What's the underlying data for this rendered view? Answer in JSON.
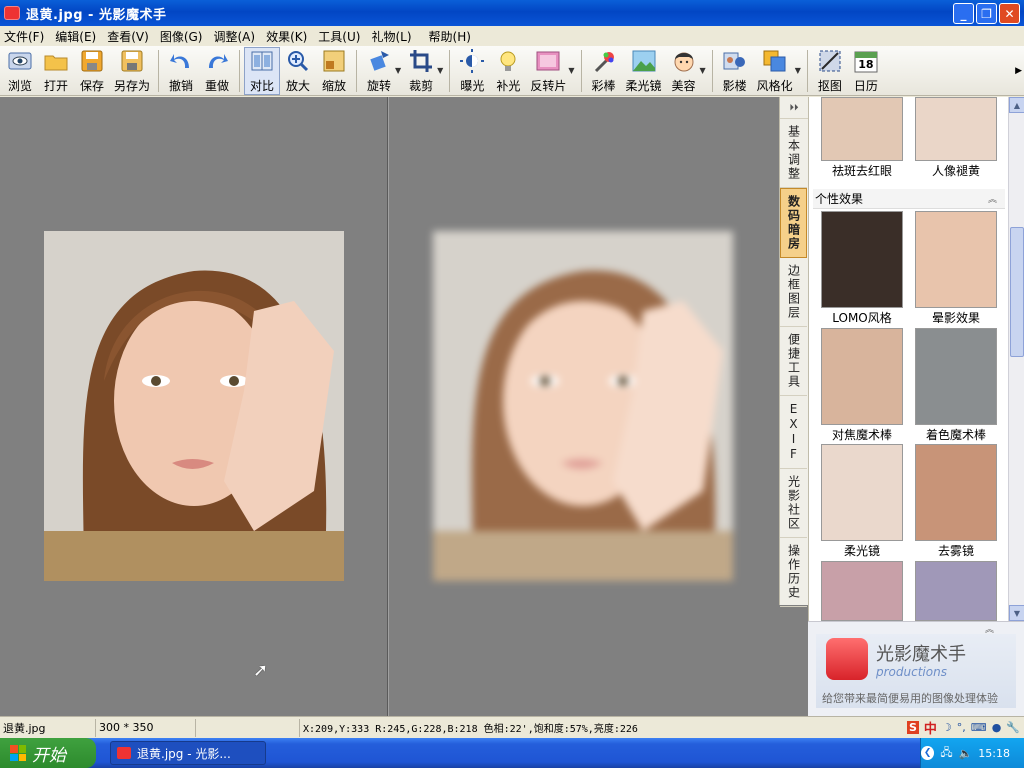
{
  "window": {
    "title": "退黄.jpg - 光影魔术手",
    "controls": {
      "minimize": "_",
      "maximize": "❐",
      "close": "✕"
    }
  },
  "menubar": [
    {
      "label": "文件(F)"
    },
    {
      "label": "编辑(E)"
    },
    {
      "label": "查看(V)"
    },
    {
      "label": "图像(G)"
    },
    {
      "label": "调整(A)"
    },
    {
      "label": "效果(K)"
    },
    {
      "label": "工具(U)"
    },
    {
      "label": "礼物(L)"
    },
    {
      "label": "帮助(H)"
    }
  ],
  "toolbar": {
    "browse": "浏览",
    "open": "打开",
    "save": "保存",
    "save_as": "另存为",
    "undo": "撤销",
    "redo": "重做",
    "compare": "对比",
    "zoom_in": "放大",
    "scale": "缩放",
    "rotate": "旋转",
    "crop": "裁剪",
    "exposure": "曝光",
    "fill_light": "补光",
    "invert": "反转片",
    "color_pen": "彩棒",
    "soft_light": "柔光镜",
    "beauty": "美容",
    "shadow": "影楼",
    "stylize": "风格化",
    "cutout": "抠图",
    "calendar": "日历",
    "calendar_day": "18"
  },
  "vertical_tabs": {
    "top_arrow": "⏵⏵",
    "tabs": [
      "基本调整",
      "数码暗房",
      "边框图层",
      "便捷工具",
      "EXIF",
      "光影社区",
      "操作历史"
    ],
    "active": "数码暗房"
  },
  "effects_panel": {
    "top_labels": [
      "祛斑去红眼",
      "人像褪黄"
    ],
    "section_title": "个性效果",
    "section_collapse": "︽",
    "items": [
      {
        "label": "LOMO风格"
      },
      {
        "label": "晕影效果"
      },
      {
        "label": "对焦魔术棒"
      },
      {
        "label": "着色魔术棒"
      },
      {
        "label": "柔光镜"
      },
      {
        "label": "去雾镜"
      }
    ],
    "scroll_up": "▲",
    "scroll_down": "▼"
  },
  "brand": {
    "collapse": "︽",
    "name": "光影魔术手",
    "sub": "productions",
    "slogan": "给您带来最简便易用的图像处理体验"
  },
  "statusbar": {
    "filename": "退黄.jpg",
    "dimensions": "300 * 350",
    "pixel_info": "X:209,Y:333 R:245,G:228,B:218 色相:22',饱和度:57%,亮度:226"
  },
  "taskbar": {
    "start": "开始",
    "task": "退黄.jpg - 光影...",
    "clock": "15:18"
  },
  "colors": {
    "title_bar": "#0a54d6",
    "canvas_bg": "#808080",
    "active_tab": "#f5d08a",
    "start_button": "#3fa13f"
  }
}
